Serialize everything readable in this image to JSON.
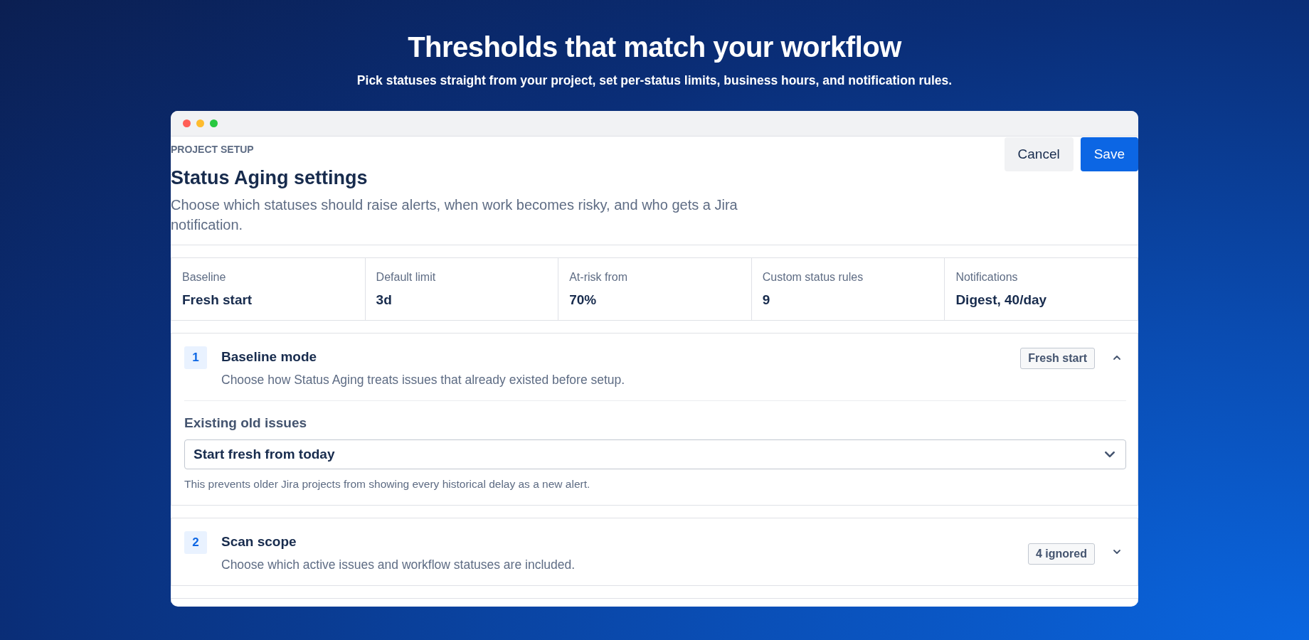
{
  "hero": {
    "title": "Thresholds that match your workflow",
    "subtitle": "Pick statuses straight from your project, set per-status limits, business hours, and notification rules."
  },
  "header": {
    "eyebrow": "PROJECT SETUP",
    "title": "Status Aging settings",
    "description": "Choose which statuses should raise alerts, when work becomes risky, and who gets a Jira notification.",
    "buttons": [
      {
        "label": "Cancel",
        "kind": "secondary"
      },
      {
        "label": "Save",
        "kind": "primary"
      }
    ]
  },
  "stats": [
    {
      "label": "Baseline",
      "value": "Fresh start"
    },
    {
      "label": "Default limit",
      "value": "3d"
    },
    {
      "label": "At-risk from",
      "value": "70%"
    },
    {
      "label": "Custom status rules",
      "value": "9"
    },
    {
      "label": "Notifications",
      "value": "Digest, 40/day"
    }
  ],
  "sections": [
    {
      "number": "1",
      "title": "Baseline mode",
      "description": "Choose how Status Aging treats issues that already existed before setup.",
      "badge": "Fresh start",
      "expanded": true,
      "field": {
        "label": "Existing old issues",
        "value": "Start fresh from today",
        "help": "This prevents older Jira projects from showing every historical delay as a new alert."
      }
    },
    {
      "number": "2",
      "title": "Scan scope",
      "description": "Choose which active issues and workflow statuses are included.",
      "badge": "4 ignored",
      "expanded": false
    }
  ]
}
